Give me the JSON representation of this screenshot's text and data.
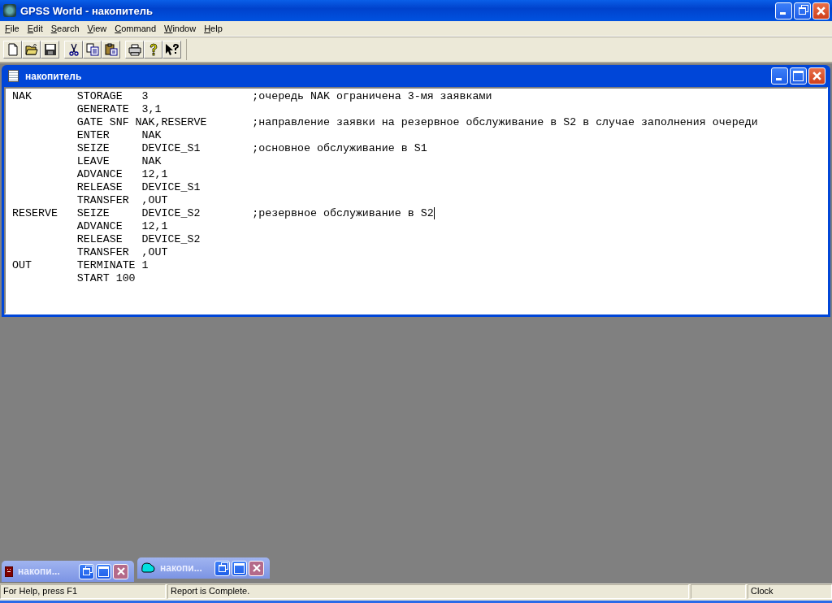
{
  "window": {
    "title": "GPSS World - накопитель"
  },
  "menu": [
    "File",
    "Edit",
    "Search",
    "View",
    "Command",
    "Window",
    "Help"
  ],
  "toolbar": [
    [
      {
        "kind": "new"
      },
      {
        "kind": "open"
      },
      {
        "kind": "save"
      }
    ],
    [
      {
        "kind": "cut"
      },
      {
        "kind": "copy"
      },
      {
        "kind": "paste"
      }
    ],
    [
      {
        "kind": "print"
      },
      {
        "kind": "help"
      },
      {
        "kind": "context-help"
      }
    ]
  ],
  "editor": {
    "title": "накопитель",
    "lines": [
      {
        "label": "NAK",
        "statement": "STORAGE   3",
        "comment": ";очередь NAK ограничена 3-мя заявками",
        "caret": false
      },
      {
        "statement": "GENERATE  3,1",
        "caret": false
      },
      {
        "statement": "GATE SNF NAK,RESERVE",
        "comment": ";направление заявки на резервное обслуживание в S2 в случае заполнения очереди",
        "caret": false
      },
      {
        "statement": "ENTER     NAK",
        "caret": false
      },
      {
        "statement": "SEIZE     DEVICE_S1",
        "comment": ";основное обслуживание в S1",
        "caret": false
      },
      {
        "statement": "LEAVE     NAK",
        "caret": false
      },
      {
        "statement": "ADVANCE   12,1",
        "caret": false
      },
      {
        "statement": "RELEASE   DEVICE_S1",
        "caret": false
      },
      {
        "statement": "TRANSFER  ,OUT",
        "caret": false
      },
      {
        "label": "RESERVE",
        "statement": "SEIZE     DEVICE_S2",
        "comment": ";резервное обслуживание в S2",
        "caret": true
      },
      {
        "statement": "ADVANCE   12,1",
        "caret": false
      },
      {
        "statement": "RELEASE   DEVICE_S2",
        "caret": false
      },
      {
        "statement": "TRANSFER  ,OUT",
        "caret": false
      },
      {
        "label": "OUT",
        "statement": "TERMINATE 1",
        "caret": false
      },
      {
        "statement": "START 100",
        "caret": false
      }
    ]
  },
  "minimized_windows": [
    {
      "title": "накопи...",
      "kind": "report"
    },
    {
      "title": "накопи...",
      "kind": "journal"
    }
  ],
  "status_bar": [
    "For Help, press F1",
    "Report is Complete.",
    "Clock"
  ]
}
